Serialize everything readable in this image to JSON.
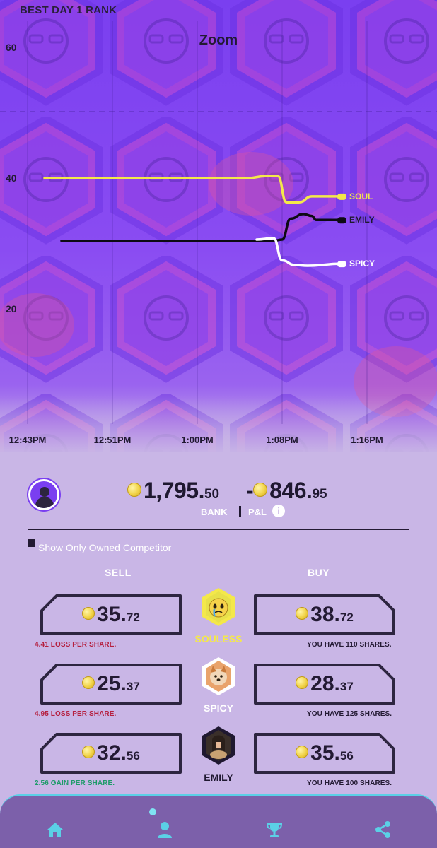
{
  "chart": {
    "header": "BEST DAY 1 RANK",
    "zoom_label": "Zoom"
  },
  "chart_data": {
    "type": "line",
    "title": "BEST DAY 1 RANK",
    "yticks": [
      20,
      40,
      60
    ],
    "ylim": [
      12,
      62
    ],
    "xticks": [
      "12:43PM",
      "12:51PM",
      "1:00PM",
      "1:08PM",
      "1:16PM"
    ],
    "xlim": [
      0,
      40
    ],
    "series": [
      {
        "name": "SOUL",
        "color": "#f4e84a",
        "points": [
          [
            2,
            40
          ],
          [
            26,
            40
          ],
          [
            28,
            40.3
          ],
          [
            29.5,
            40.3
          ],
          [
            30.5,
            36.3
          ],
          [
            32,
            36.3
          ],
          [
            33.5,
            37.2
          ],
          [
            37,
            37.2
          ]
        ]
      },
      {
        "name": "EMILY",
        "color": "#0d0a14",
        "points": [
          [
            4,
            30.4
          ],
          [
            29,
            30.4
          ],
          [
            30,
            30.6
          ],
          [
            31,
            33.8
          ],
          [
            32.5,
            34.5
          ],
          [
            33.5,
            34.2
          ],
          [
            34,
            33.6
          ],
          [
            37,
            33.6
          ]
        ]
      },
      {
        "name": "SPICY",
        "color": "#ffffff",
        "points": [
          [
            27,
            30.6
          ],
          [
            29,
            30.8
          ],
          [
            30,
            27.4
          ],
          [
            31.5,
            26.7
          ],
          [
            33,
            26.6
          ],
          [
            37,
            26.9
          ]
        ]
      }
    ]
  },
  "summary": {
    "bank_whole": "1,795.",
    "bank_cents": "50",
    "pl_sign": "-",
    "pl_whole": "846.",
    "pl_cents": "95",
    "bank_label": "BANK",
    "pl_label": "P&L",
    "info_icon": "i"
  },
  "filter": {
    "label": "Show Only Owned Competitor",
    "checked": true
  },
  "columns": {
    "sell": "SELL",
    "buy": "BUY"
  },
  "competitors": [
    {
      "name": "SOULESS",
      "name_color": "#f4e84a",
      "sell_whole": "35.",
      "sell_cents": "72",
      "buy_whole": "38.",
      "buy_cents": "72",
      "sell_note": "4.41 LOSS PER SHARE.",
      "sell_note_kind": "loss",
      "buy_note": "YOU HAVE 110 SHARES.",
      "avatar_icon": "crying-emoji-icon"
    },
    {
      "name": "SPICY",
      "name_color": "#ffffff",
      "sell_whole": "25.",
      "sell_cents": "37",
      "buy_whole": "28.",
      "buy_cents": "37",
      "sell_note": "4.95 LOSS PER SHARE.",
      "sell_note_kind": "loss",
      "buy_note": "YOU HAVE 125 SHARES.",
      "avatar_icon": "dog-photo-icon"
    },
    {
      "name": "EMILY",
      "name_color": "#1f1830",
      "sell_whole": "32.",
      "sell_cents": "56",
      "buy_whole": "35.",
      "buy_cents": "56",
      "sell_note": "2.56 GAIN PER SHARE.",
      "sell_note_kind": "gain",
      "buy_note": "YOU HAVE 100 SHARES.",
      "avatar_icon": "person-photo-icon"
    }
  ],
  "nav": {
    "items": [
      "home-icon",
      "profile-icon",
      "trophy-icon",
      "share-icon"
    ],
    "active": 1,
    "color": "#5bd0e6"
  }
}
